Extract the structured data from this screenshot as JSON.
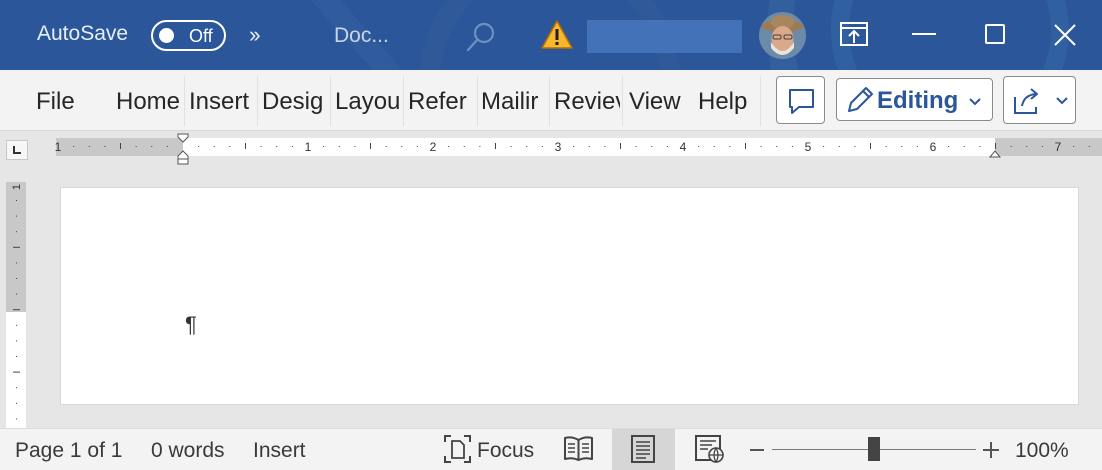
{
  "titlebar": {
    "autosave_label": "AutoSave",
    "autosave_state": "Off",
    "more_icon": "chevron-double-right-icon",
    "doc_title": "Doc...",
    "accent_color": "#2b579a"
  },
  "ribbon": {
    "tabs": [
      "File",
      "Home",
      "Insert",
      "Desig",
      "Layou",
      "Refer",
      "Mailir",
      "Reviev",
      "View",
      "Help"
    ],
    "editing_label": "Editing",
    "editing_color": "#2b579a"
  },
  "ruler": {
    "numbers": [
      "1",
      "1",
      "2",
      "3",
      "4",
      "5",
      "6",
      "7"
    ],
    "vertical_number": "1"
  },
  "document": {
    "pilcrow": "¶"
  },
  "statusbar": {
    "page": "Page 1 of 1",
    "words": "0 words",
    "mode": "Insert",
    "focus_label": "Focus",
    "zoom": "100%"
  }
}
